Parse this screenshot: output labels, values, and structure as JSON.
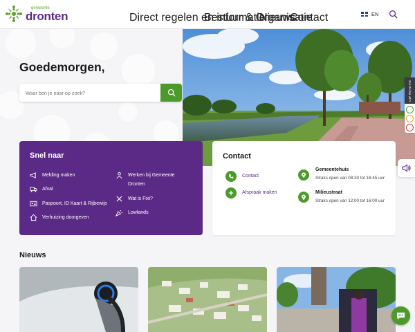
{
  "header": {
    "logo_small": "gemeente",
    "logo_big": "dronten",
    "nav": [
      {
        "label": "Direct regelen en informatie",
        "has_dropdown": true
      },
      {
        "label": "Bestuur & Organisatie",
        "has_dropdown": false
      },
      {
        "label": "Nieuws",
        "has_dropdown": true
      },
      {
        "label": "Contact",
        "has_dropdown": false
      }
    ],
    "language": "EN",
    "search_icon": "search-icon"
  },
  "hero": {
    "greeting": "Goedemorgen,",
    "search_placeholder": "Waar ben je naar op zoek?"
  },
  "side_widget": {
    "label": "UW REACTIE"
  },
  "snel_naar": {
    "title": "Snel naar",
    "left": [
      {
        "label": "Melding maken",
        "icon": "megaphone-icon"
      },
      {
        "label": "Afval",
        "icon": "truck-icon"
      },
      {
        "label": "Paspoort, ID Kaart & Rijbewijs",
        "icon": "id-card-icon"
      },
      {
        "label": "Verhuizing doorgeven",
        "icon": "house-icon"
      }
    ],
    "right": [
      {
        "label_line1": "Werken bij Gemeente",
        "label_line2": "Dronten",
        "icon": "person-icon"
      },
      {
        "label": "Wat is Fixi?",
        "icon": "tools-icon"
      },
      {
        "label": "Lowlands",
        "icon": "party-icon"
      }
    ]
  },
  "contact": {
    "title": "Contact",
    "links": [
      "Contact",
      "Afspraak maken"
    ],
    "locations": [
      {
        "name": "Gemeentehuis",
        "hours": "Straks open van 08:30 tot 16:45 uur"
      },
      {
        "name": "Milieustraat",
        "hours": "Straks open van 12:00 tot 16:00 uur"
      }
    ]
  },
  "news": {
    "title": "Nieuws"
  },
  "colors": {
    "purple": "#5b2a86",
    "green": "#4c9a2a",
    "background": "#f5f5f7"
  }
}
